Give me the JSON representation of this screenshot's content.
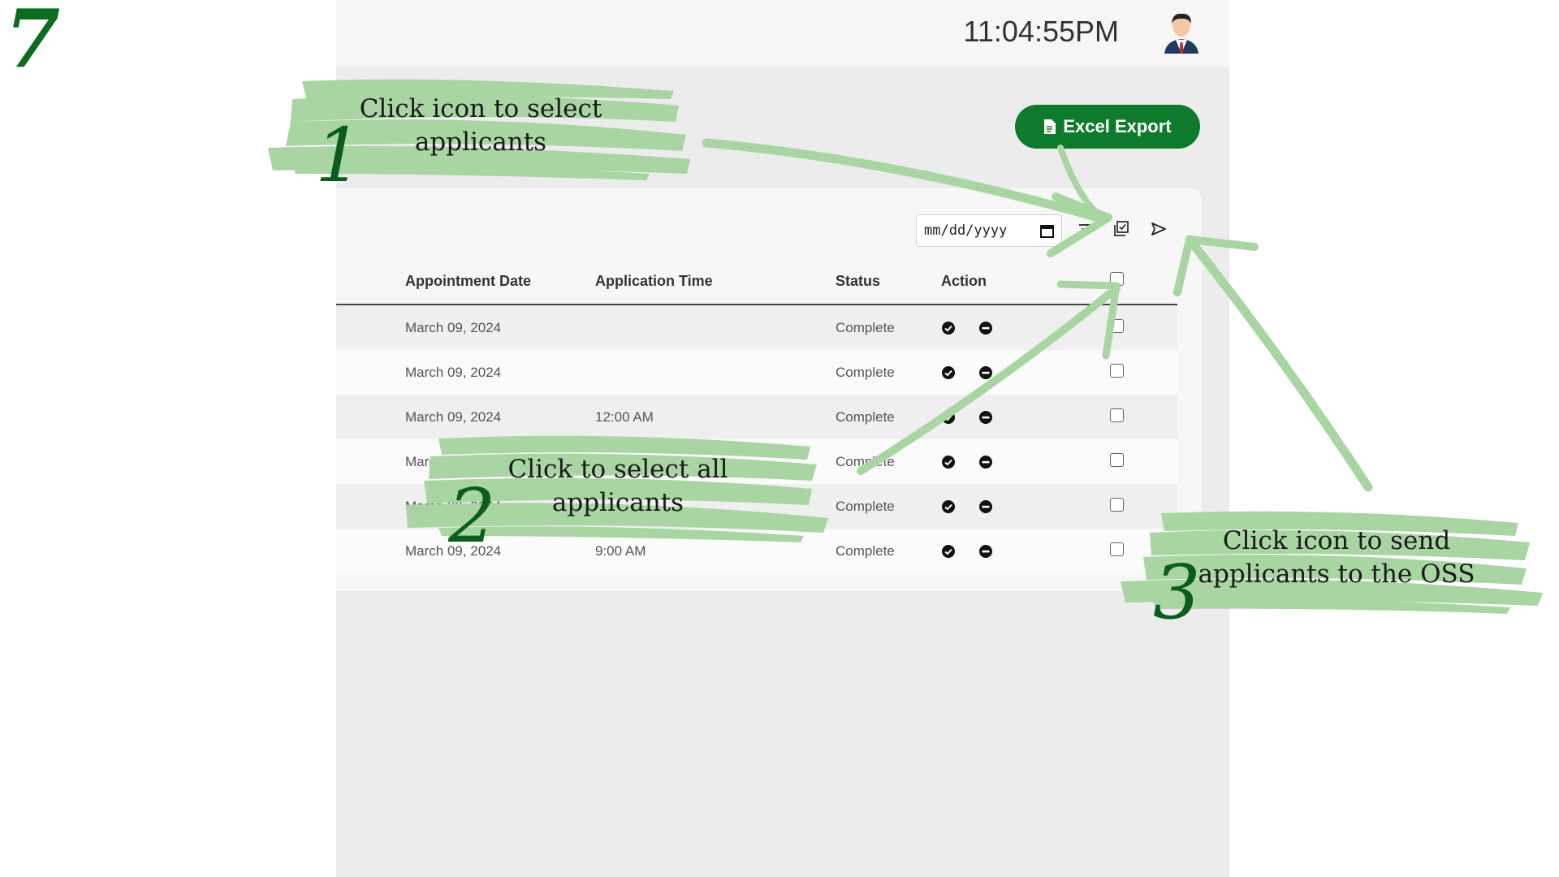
{
  "step_number": "7",
  "header": {
    "clock": "11:04:55PM"
  },
  "toolbar": {
    "excel_export_label": "Excel Export",
    "date_placeholder": "mm/dd/yyyy"
  },
  "table": {
    "columns": [
      "Appointment Date",
      "Application Time",
      "Status",
      "Action"
    ],
    "rows": [
      {
        "date": "March 09, 2024",
        "time": "",
        "status": "Complete"
      },
      {
        "date": "March 09, 2024",
        "time": "",
        "status": "Complete"
      },
      {
        "date": "March 09, 2024",
        "time": "12:00 AM",
        "status": "Complete"
      },
      {
        "date": "March 09, 2024",
        "time": "",
        "status": "Complete"
      },
      {
        "date": "March 09, 2024",
        "time": "",
        "status": "Complete"
      },
      {
        "date": "March 09, 2024",
        "time": "9:00 AM",
        "status": "Complete"
      }
    ]
  },
  "annotations": [
    {
      "number": "1",
      "text_line1": "Click icon to select",
      "text_line2": "applicants"
    },
    {
      "number": "2",
      "text_line1": "Click to select all",
      "text_line2": "applicants"
    },
    {
      "number": "3",
      "text_line1": "Click icon to send",
      "text_line2": "applicants to the OSS"
    }
  ],
  "colors": {
    "brand_green": "#0e7a2b",
    "annotation_green": "#a8d5a2",
    "number_green": "#0a5d1a"
  }
}
